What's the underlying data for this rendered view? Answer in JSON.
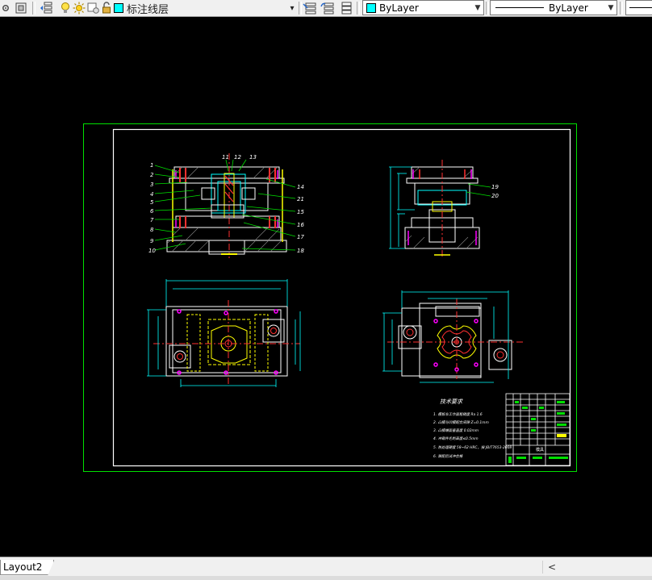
{
  "toolbar": {
    "layer_name": "标注线层",
    "layer_color": "#00ffff",
    "color_combo": {
      "value": "ByLayer",
      "swatch_color": "#00ffff"
    },
    "linetype_combo": {
      "value": "ByLayer"
    }
  },
  "drawing": {
    "tech_req_title": "技术要求",
    "tech_req_lines": [
      "1. 模板非工作面粗糙度 Ra 1.6",
      "2. 凸模与凹模配合间隙 Z=0.1mm",
      "3. 凸模端面垂直度 0.02mm",
      "4. 冲裁件毛刺高度≤0.5mm",
      "5. 热处理硬度 58~62 HRC，按 JB/T7653-2008",
      "6. 装配后试冲合格"
    ],
    "balloons_left": [
      "1",
      "2",
      "3",
      "4",
      "5",
      "6",
      "7",
      "8",
      "9",
      "10"
    ],
    "balloons_top": [
      "11",
      "12",
      "13"
    ],
    "balloons_right": [
      "14",
      "21",
      "15",
      "16",
      "17",
      "18"
    ],
    "balloons_side": [
      "19",
      "20"
    ],
    "title_block_caption": "模具"
  },
  "status": {
    "layout_tab": "Layout2",
    "scroll_left_glyph": "<"
  }
}
